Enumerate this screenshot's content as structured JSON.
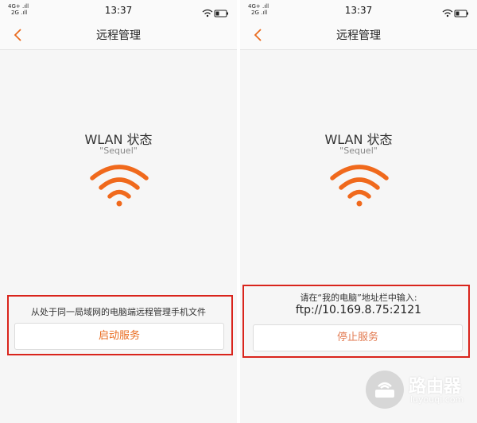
{
  "left": {
    "status_bar": {
      "network_top": "4G+ .ıll",
      "network_bottom": "2G .ıll",
      "time": "13:37"
    },
    "nav_title": "远程管理",
    "wlan_title": "WLAN 状态",
    "ssid": "\"Sequel\"",
    "hint": "从处于同一局域网的电脑端远程管理手机文件",
    "button_label": "启动服务"
  },
  "right": {
    "status_bar": {
      "network_top": "4G+ .ıll",
      "network_bottom": "2G .ıll",
      "time": "13:37"
    },
    "nav_title": "远程管理",
    "wlan_title": "WLAN 状态",
    "ssid": "\"Sequel\"",
    "hint": "请在“我的电脑”地址栏中输入:",
    "ftp_address": "ftp://10.169.8.75:2121",
    "button_label": "停止服务"
  },
  "watermark": {
    "title": "路由器",
    "subtitle": "luyouqi.com"
  },
  "colors": {
    "accent": "#f0691c",
    "highlight_frame": "#d9241c"
  }
}
